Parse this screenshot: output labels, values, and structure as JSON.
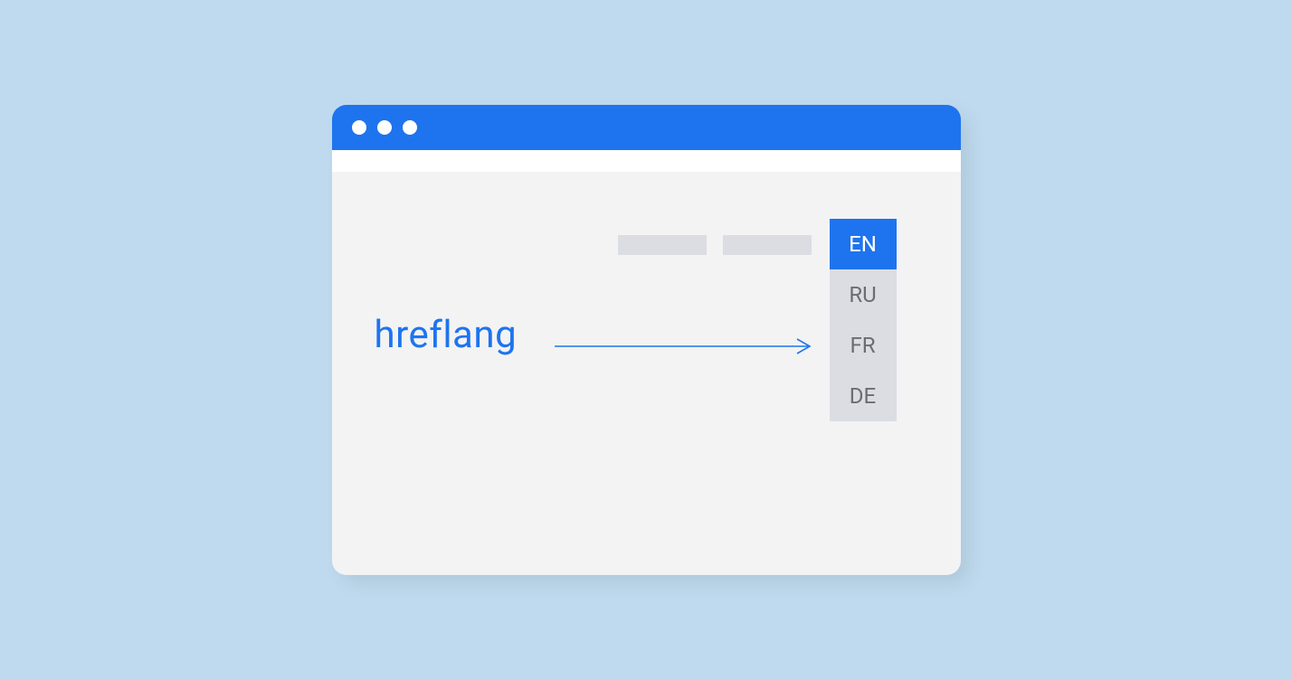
{
  "colors": {
    "page_bg": "#bfdaef",
    "window_bg": "#f3f3f4",
    "accent": "#1e74ee",
    "placeholder": "#dcdde2",
    "muted_text": "#6b6d72",
    "white": "#ffffff"
  },
  "label": "hreflang",
  "languages": {
    "selected": "EN",
    "options": [
      "RU",
      "FR",
      "DE"
    ]
  }
}
